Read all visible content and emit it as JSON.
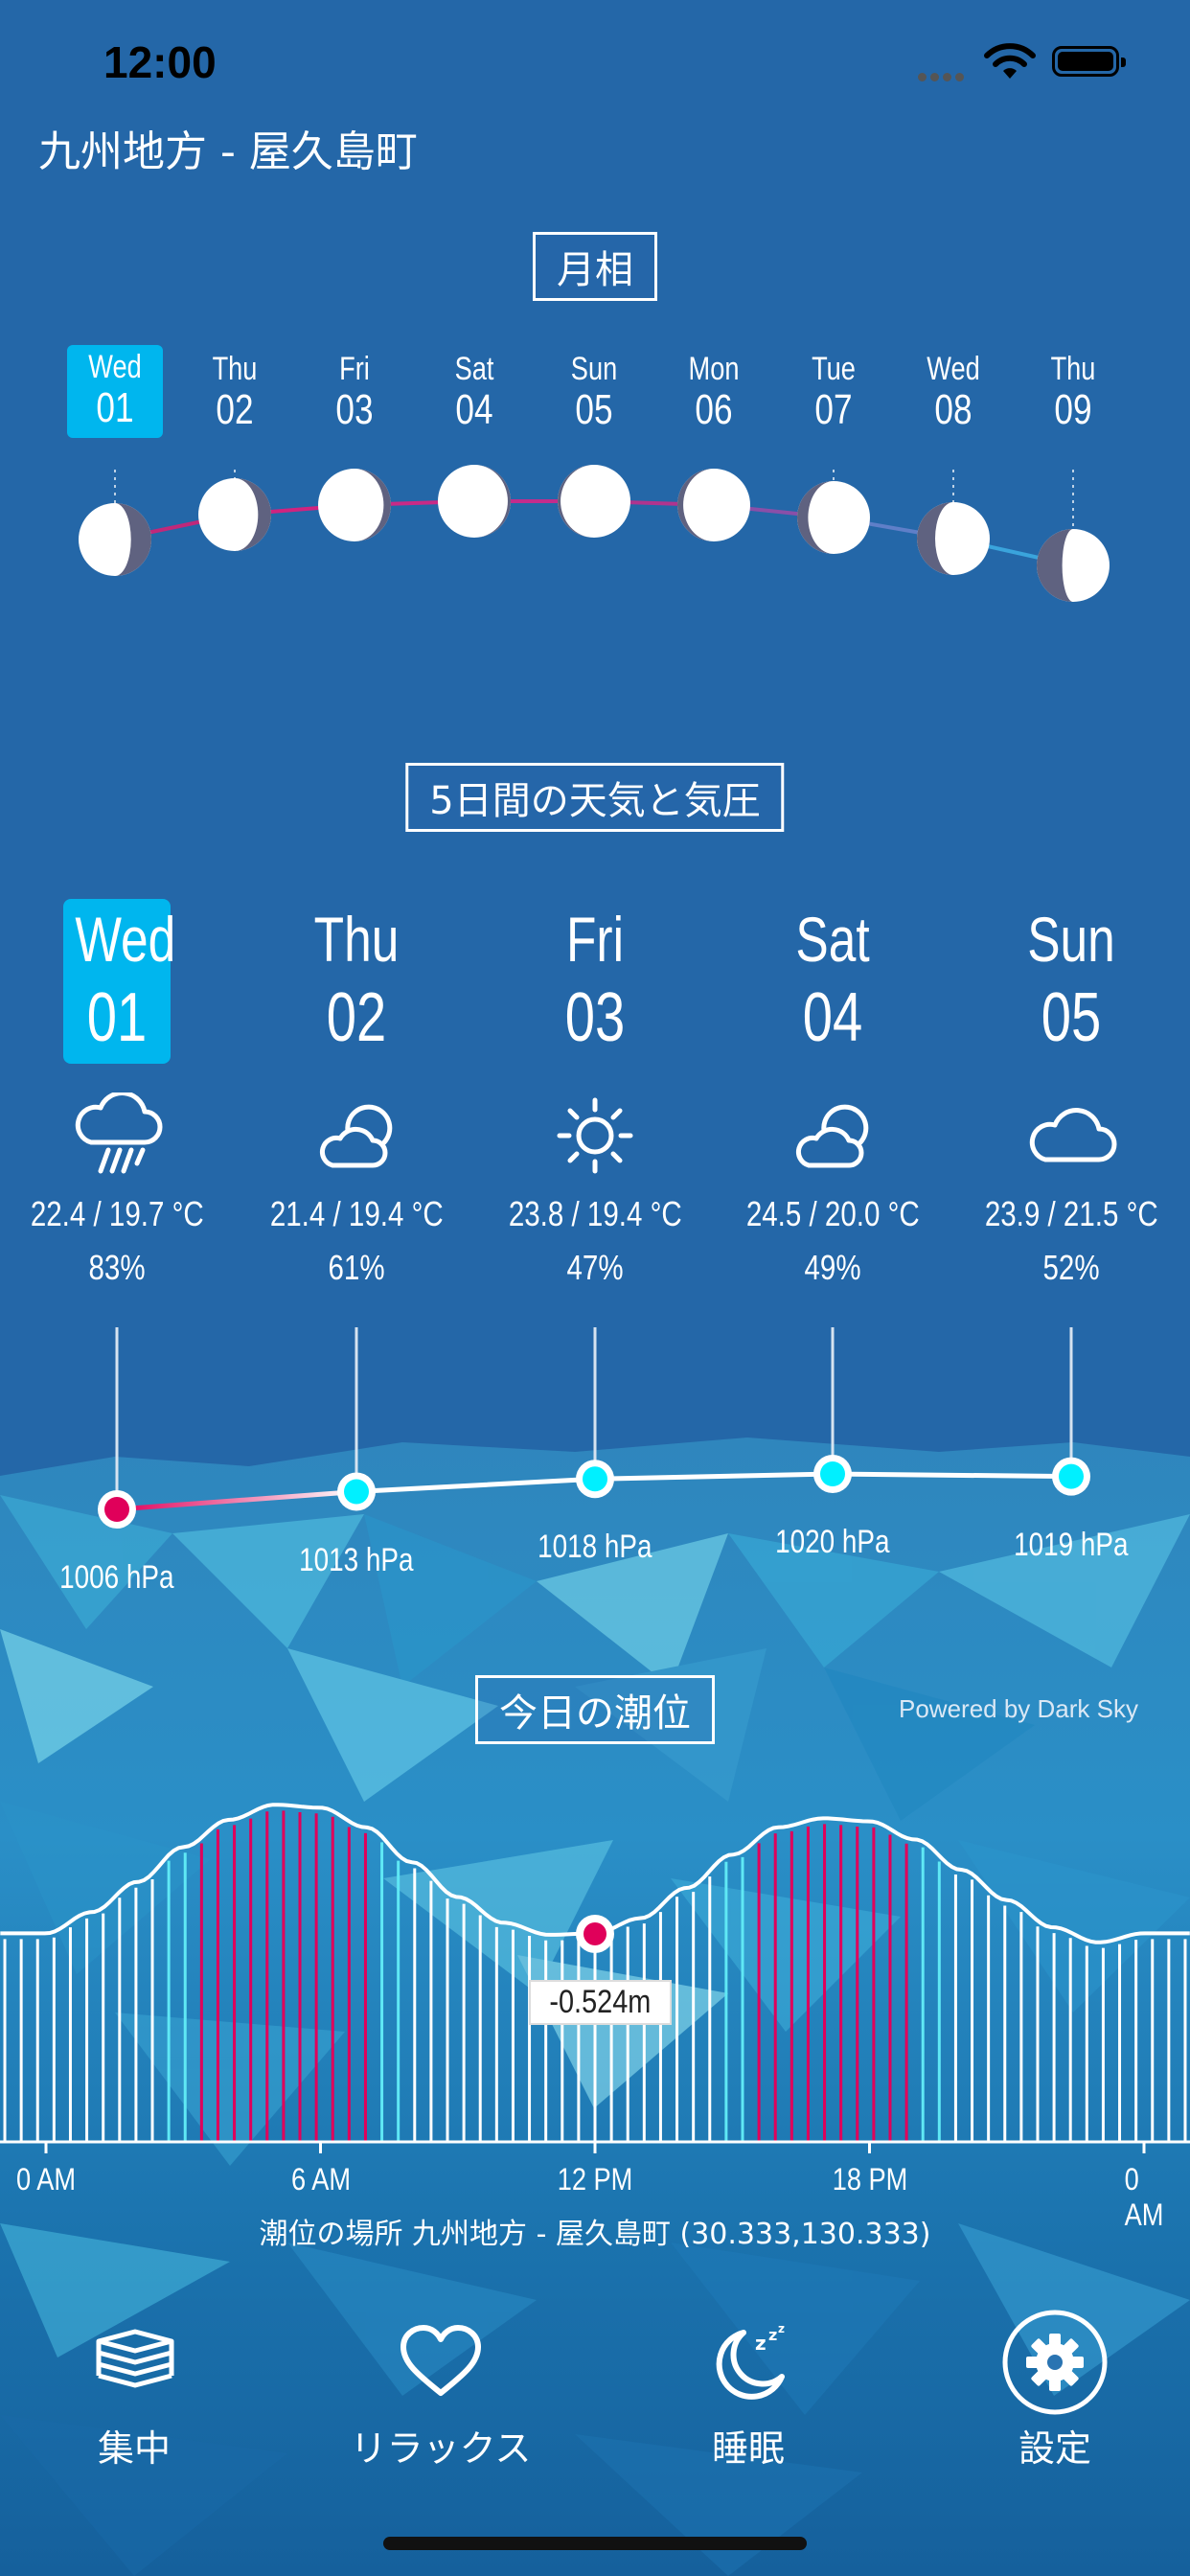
{
  "status_bar": {
    "time": "12:00"
  },
  "location_title": "九州地方 - 屋久島町",
  "moon_section": {
    "title": "月相",
    "days": [
      {
        "dow": "Wed",
        "day": "01",
        "selected": true,
        "illum": 0.28,
        "waxing": false
      },
      {
        "dow": "Thu",
        "day": "02",
        "selected": false,
        "illum": 0.18,
        "waxing": false
      },
      {
        "dow": "Fri",
        "day": "03",
        "selected": false,
        "illum": 0.1,
        "waxing": false
      },
      {
        "dow": "Sat",
        "day": "04",
        "selected": false,
        "illum": 0.02,
        "waxing": false
      },
      {
        "dow": "Sun",
        "day": "05",
        "selected": false,
        "illum": 0.02,
        "waxing": true
      },
      {
        "dow": "Mon",
        "day": "06",
        "selected": false,
        "illum": 0.08,
        "waxing": true
      },
      {
        "dow": "Tue",
        "day": "07",
        "selected": false,
        "illum": 0.15,
        "waxing": true
      },
      {
        "dow": "Wed",
        "day": "08",
        "selected": false,
        "illum": 0.25,
        "waxing": true
      },
      {
        "dow": "Thu",
        "day": "09",
        "selected": false,
        "illum": 0.35,
        "waxing": true
      }
    ]
  },
  "weather_section": {
    "title": "5日間の天気と気圧",
    "days": [
      {
        "dow": "Wed",
        "day": "01",
        "selected": true,
        "icon": "rain-cloud-icon",
        "temp": "22.4 / 19.7 °C",
        "humidity": "83%",
        "pressure": "1006 hPa",
        "pressure_value": 1006
      },
      {
        "dow": "Thu",
        "day": "02",
        "selected": false,
        "icon": "partly-cloudy-icon",
        "temp": "21.4 / 19.4 °C",
        "humidity": "61%",
        "pressure": "1013 hPa",
        "pressure_value": 1013
      },
      {
        "dow": "Fri",
        "day": "03",
        "selected": false,
        "icon": "sun-icon",
        "temp": "23.8 / 19.4 °C",
        "humidity": "47%",
        "pressure": "1018 hPa",
        "pressure_value": 1018
      },
      {
        "dow": "Sat",
        "day": "04",
        "selected": false,
        "icon": "partly-cloudy-icon",
        "temp": "24.5 / 20.0 °C",
        "humidity": "49%",
        "pressure": "1020 hPa",
        "pressure_value": 1020
      },
      {
        "dow": "Sun",
        "day": "05",
        "selected": false,
        "icon": "cloud-icon",
        "temp": "23.9 / 21.5 °C",
        "humidity": "52%",
        "pressure": "1019 hPa",
        "pressure_value": 1019
      }
    ],
    "powered_by": "Powered by Dark Sky"
  },
  "tide_section": {
    "title": "今日の潮位",
    "current_label": "-0.524m",
    "ticks": [
      "0 AM",
      "6 AM",
      "12 PM",
      "18 PM",
      "0 AM"
    ],
    "place": "潮位の場所 九州地方 - 屋久島町 (30.333,130.333)"
  },
  "chart_data": {
    "type": "area",
    "title": "今日の潮位",
    "x_ticks": [
      "0 AM",
      "6 AM",
      "12 PM",
      "18 PM",
      "0 AM"
    ],
    "x_hours": [
      0,
      1,
      2,
      3,
      4,
      5,
      6,
      7,
      8,
      9,
      10,
      11,
      12,
      13,
      14,
      15,
      16,
      17,
      18,
      19,
      20,
      21,
      22,
      23,
      24
    ],
    "y_m": [
      -0.52,
      -0.38,
      -0.18,
      0.05,
      0.23,
      0.33,
      0.31,
      0.18,
      -0.05,
      -0.28,
      -0.45,
      -0.53,
      -0.52,
      -0.42,
      -0.22,
      0.0,
      0.18,
      0.24,
      0.22,
      0.1,
      -0.1,
      -0.3,
      -0.48,
      -0.58,
      -0.52
    ],
    "current": {
      "x": 12,
      "y": -0.524,
      "label": "-0.524m"
    }
  },
  "tabs": [
    {
      "label": "集中",
      "icon": "books-icon"
    },
    {
      "label": "リラックス",
      "icon": "heart-icon"
    },
    {
      "label": "睡眠",
      "icon": "moon-sleep-icon"
    },
    {
      "label": "設定",
      "icon": "gear-icon"
    }
  ],
  "colors": {
    "background": "#2467a8",
    "accent": "#00b6ee",
    "pressure_low": "#e0005a",
    "pressure_high": "#00f0ff",
    "moon_dark": "#5f6280"
  }
}
